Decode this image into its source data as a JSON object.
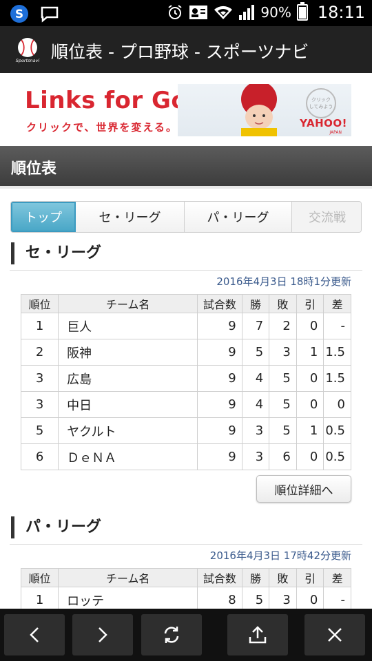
{
  "status_bar": {
    "battery": "90%",
    "time": "18:11",
    "icons": [
      "s-app-icon",
      "chat-bubble-icon",
      "alarm-icon",
      "contact-card-icon",
      "wifi-icon",
      "signal-icon",
      "battery-icon"
    ]
  },
  "window": {
    "title": "順位表 - プロ野球 - スポーツナビ",
    "icon_label": "Sportsnavi"
  },
  "ad": {
    "headline": "Links for Good",
    "tagline": "クリックで、世界を変える。",
    "brand": "YAHOO!",
    "brand_sub": "JAPAN",
    "badge": "クリック\nしてみよう"
  },
  "section_header": "順位表",
  "tabs": [
    {
      "label": "トップ",
      "state": "active"
    },
    {
      "label": "セ・リーグ",
      "state": "normal"
    },
    {
      "label": "パ・リーグ",
      "state": "normal"
    },
    {
      "label": "交流戦",
      "state": "disabled"
    }
  ],
  "columns": [
    "順位",
    "チーム名",
    "試合数",
    "勝",
    "敗",
    "引",
    "差"
  ],
  "central": {
    "title": "セ・リーグ",
    "updated": "2016年4月3日 18時1分更新",
    "rows": [
      {
        "rank": "1",
        "team": "巨人",
        "games": "9",
        "w": "7",
        "l": "2",
        "t": "0",
        "gb": "-"
      },
      {
        "rank": "2",
        "team": "阪神",
        "games": "9",
        "w": "5",
        "l": "3",
        "t": "1",
        "gb": "1.5"
      },
      {
        "rank": "3",
        "team": "広島",
        "games": "9",
        "w": "4",
        "l": "5",
        "t": "0",
        "gb": "1.5"
      },
      {
        "rank": "3",
        "team": "中日",
        "games": "9",
        "w": "4",
        "l": "5",
        "t": "0",
        "gb": "0"
      },
      {
        "rank": "5",
        "team": "ヤクルト",
        "games": "9",
        "w": "3",
        "l": "5",
        "t": "1",
        "gb": "0.5"
      },
      {
        "rank": "6",
        "team": "ＤｅＮＡ",
        "games": "9",
        "w": "3",
        "l": "6",
        "t": "0",
        "gb": "0.5"
      }
    ],
    "detail_button": "順位詳細へ"
  },
  "pacific": {
    "title": "パ・リーグ",
    "updated": "2016年4月3日 17時42分更新",
    "rows": [
      {
        "rank": "1",
        "team": "ロッテ",
        "games": "8",
        "w": "5",
        "l": "3",
        "t": "0",
        "gb": "-"
      }
    ]
  },
  "bottom_nav": [
    "back-icon",
    "forward-icon",
    "refresh-icon",
    "share-icon",
    "close-icon"
  ],
  "colors": {
    "accent_blue": "#4aa7c7",
    "link_blue": "#1a5fb8",
    "ad_red": "#d92630"
  }
}
